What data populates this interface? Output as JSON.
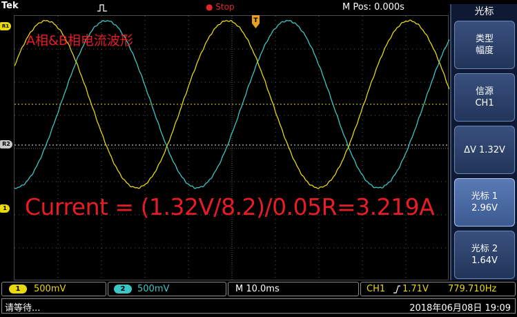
{
  "header": {
    "brand": "Tek",
    "run_status": "Stop",
    "mpos": "M Pos: 0.000s"
  },
  "display": {
    "title": "A相&B相电流波形",
    "measurement": "Current = (1.32V/8.2)/0.05R=3.219A",
    "markers": {
      "ref2": "R2",
      "ch1": "1",
      "ref1": "R1"
    },
    "colors": {
      "ch1": "#e8d80c",
      "ch2": "#3cc7c7",
      "annotation": "#e81c24"
    }
  },
  "side_menu": {
    "title": "光标",
    "buttons": [
      {
        "line1": "类型",
        "line2": "幅度"
      },
      {
        "line1": "信源",
        "line2": "CH1"
      },
      {
        "line1": "ΔV 1.32V",
        "line2": ""
      },
      {
        "line1": "光标 1",
        "line2": "2.96V"
      },
      {
        "line1": "光标 2",
        "line2": "1.64V"
      }
    ]
  },
  "status_bar": {
    "ch1_badge": "1",
    "ch1_scale": "500mV",
    "ch2_badge": "2",
    "ch2_scale": "500mV",
    "timebase": "M 10.0ms",
    "trigger_source": "CH1",
    "trigger_level": "1.71V",
    "frequency": "779.710Hz"
  },
  "message_bar": {
    "message": "请等待...",
    "datetime": "2018年06月08日  19:09"
  }
}
